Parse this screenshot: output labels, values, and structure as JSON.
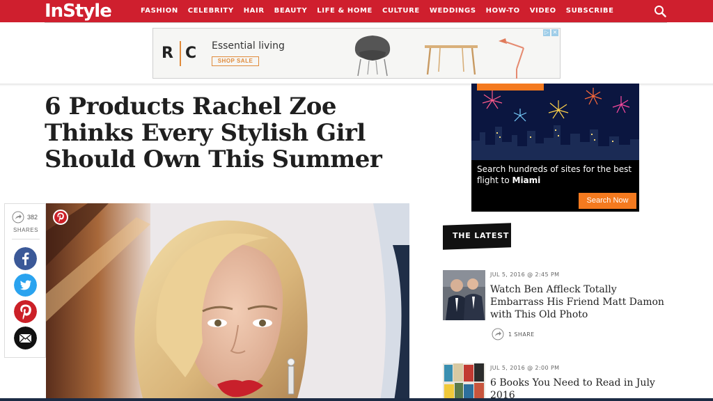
{
  "brand": {
    "logo": "InStyle",
    "accent": "#cf1f2e"
  },
  "nav": {
    "items": [
      "FASHION",
      "CELEBRITY",
      "HAIR",
      "BEAUTY",
      "LIFE & HOME",
      "CULTURE",
      "WEDDINGS",
      "HOW-TO",
      "VIDEO",
      "SUBSCRIBE"
    ],
    "search_icon": "search-icon"
  },
  "banner_ad": {
    "brand_left": "R",
    "brand_right": "C",
    "tagline": "Essential living",
    "cta": "SHOP SALE"
  },
  "article": {
    "title": "6 Products Rachel Zoe Thinks Every Stylish Girl Should Own This Summer"
  },
  "share_bar": {
    "count": "382",
    "label": "SHARES",
    "buttons": [
      "facebook-icon",
      "twitter-icon",
      "pinterest-icon",
      "email-icon"
    ]
  },
  "side_ad": {
    "text_prefix": "Search hundreds of sites for the best flight to ",
    "text_city": "Miami",
    "cta": "Search Now"
  },
  "latest": {
    "heading": "THE LATEST",
    "items": [
      {
        "date": "JUL 5, 2016 @ 2:45 PM",
        "title": "Watch Ben Affleck Totally Embarrass His Friend Matt Damon with This Old Photo",
        "shares": "1 SHARE"
      },
      {
        "date": "JUL 5, 2016 @ 2:00 PM",
        "title": "6 Books You Need to Read in July 2016"
      }
    ]
  }
}
